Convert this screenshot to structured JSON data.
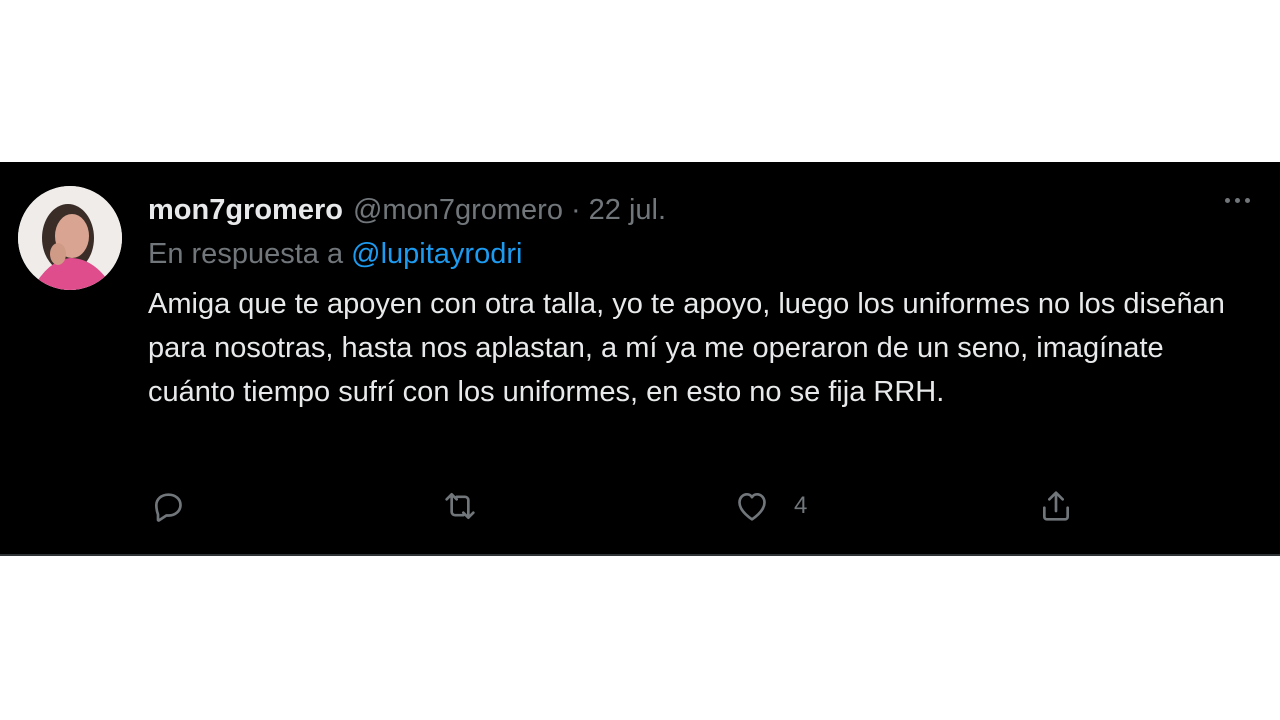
{
  "tweet": {
    "display_name": "mon7gromero",
    "handle": "@mon7gromero",
    "separator": "·",
    "date": "22 jul.",
    "reply_prefix": "En respuesta a",
    "reply_mention": "@lupitayrodri",
    "text": "Amiga que te apoyen con otra talla, yo te apoyo, luego los uniformes no los diseñan para nosotras, hasta nos aplastan, a mí ya me operaron de un seno, imagínate cuánto tiempo sufrí con los uniformes, en esto no se fija RRH.",
    "actions": {
      "reply_icon": "reply-icon",
      "retweet_icon": "retweet-icon",
      "like_icon": "heart-icon",
      "like_count": "4",
      "share_icon": "share-icon",
      "more_icon": "more-options-icon"
    }
  },
  "colors": {
    "background": "#000000",
    "text_primary": "#e7e9ea",
    "text_secondary": "#71767b",
    "link": "#1d9bf0"
  }
}
